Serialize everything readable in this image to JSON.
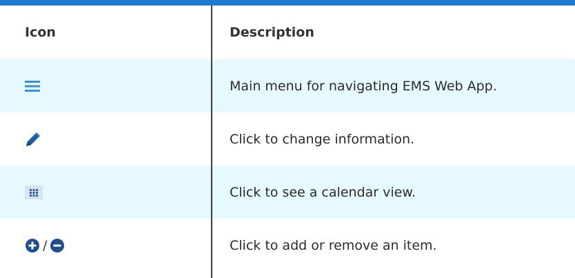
{
  "table": {
    "headers": {
      "icon": "Icon",
      "description": "Description"
    },
    "rows": [
      {
        "icon_name": "hamburger-menu-icon",
        "description": "Main menu for navigating EMS Web App."
      },
      {
        "icon_name": "pencil-icon",
        "description": "Click to change information."
      },
      {
        "icon_name": "calendar-grid-icon",
        "description": "Click to see a calendar view."
      },
      {
        "icon_name": "plus-circle-icon / minus-circle-icon",
        "separator": "/",
        "description": "Click to add or remove an item."
      }
    ]
  },
  "colors": {
    "top_bar": "#1e7ad0",
    "alt_row": "#e6f9fe",
    "icon_blue": "#3b8fd8",
    "icon_dark": "#1f4f8a"
  }
}
